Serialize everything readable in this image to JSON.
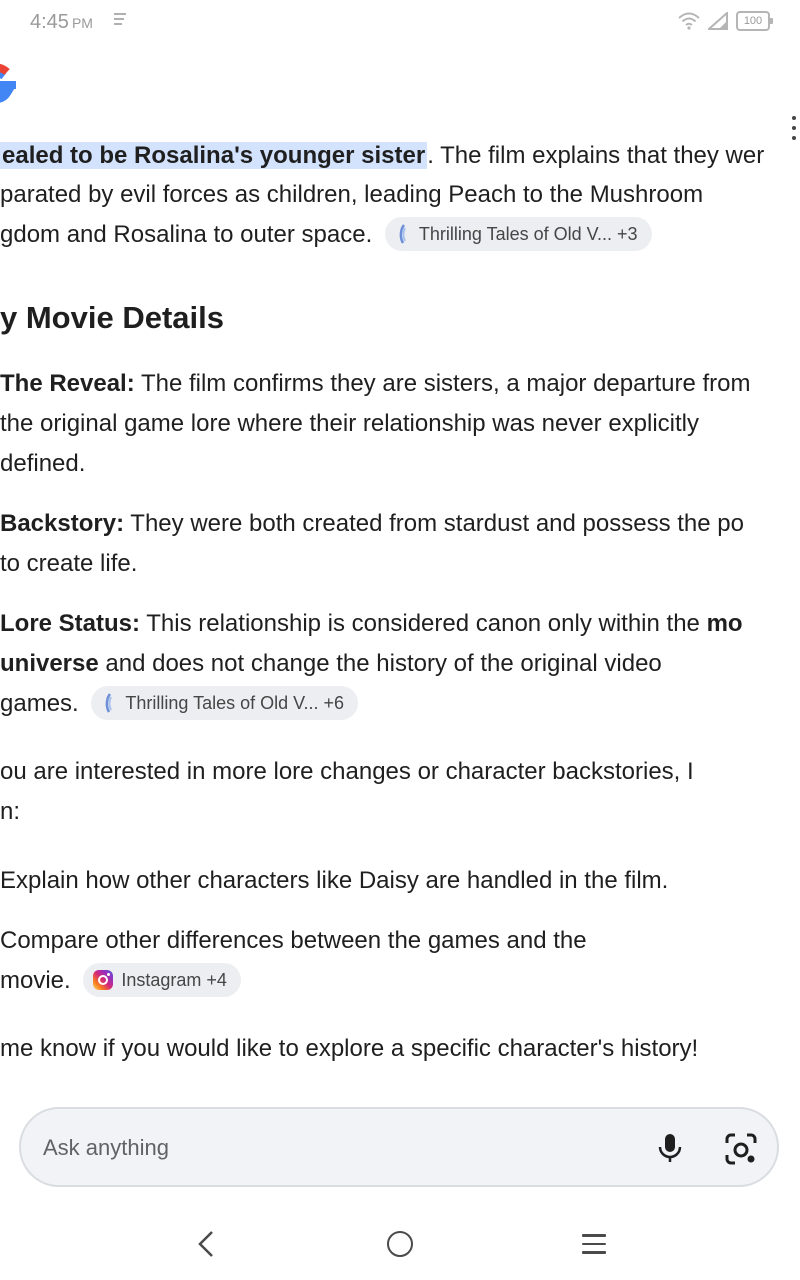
{
  "status_bar": {
    "time": "4:45",
    "ampm": "PM",
    "battery": "100",
    "icons": [
      "notification-icon",
      "wifi-icon",
      "signal-icon",
      "battery-icon"
    ]
  },
  "header": {
    "logo": "google-g-logo",
    "menu_icon": "more-vert-icon"
  },
  "content": {
    "intro": {
      "highlight": "ealed to be Rosalina's younger sister",
      "after_highlight": ". The film explains that they wer",
      "line2": "parated by evil forces as children, leading Peach to the Mushroom",
      "line3": "gdom and Rosalina to outer space.",
      "chip": "Thrilling Tales of Old V... +3"
    },
    "section_heading": "y Movie Details",
    "reveal": {
      "label": "The Reveal:",
      "line1": " The film confirms they are sisters, a major departure from",
      "line2": "the original game lore where their relationship was never explicitly",
      "line3": "defined."
    },
    "backstory": {
      "label": "Backstory:",
      "line1": " They were both created from stardust and possess the po",
      "line2": "to create life."
    },
    "lore_status": {
      "label": "Lore Status:",
      "line1": " This relationship is considered canon only within the ",
      "line1_bold": "mo",
      "line2_bold": "universe",
      "line2": " and does not change the history of the original video",
      "line3": "games.",
      "chip": "Thrilling Tales of Old V... +6"
    },
    "followup": {
      "line1": "ou are interested in more lore changes or character backstories, I",
      "line2": "n:"
    },
    "option1": "Explain how other characters like Daisy are handled in the film.",
    "option2": {
      "line1": "Compare other differences between the games and the",
      "line2": "movie.",
      "chip": "Instagram +4"
    },
    "closing": " me know if you would like to explore a specific character's history!"
  },
  "ask_bar": {
    "placeholder": "Ask anything",
    "icons": [
      "mic-icon",
      "google-lens-icon"
    ]
  },
  "nav_bar": {
    "icons": [
      "back-icon",
      "home-icon",
      "recents-icon"
    ]
  }
}
